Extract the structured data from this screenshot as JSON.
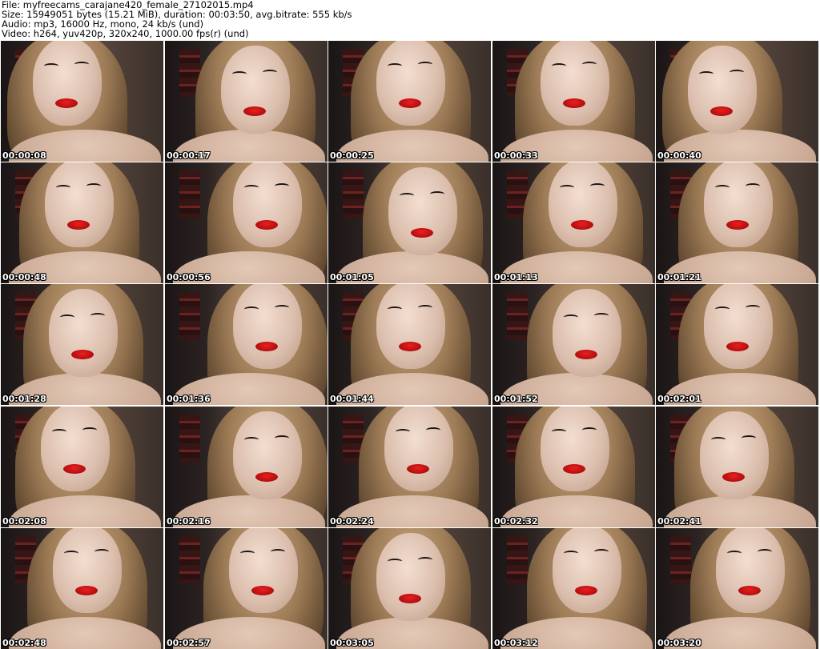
{
  "header": {
    "file": "File: myfreecams_carajane420_female_27102015.mp4",
    "size": "Size: 15949051 bytes (15.21 MiB), duration: 00:03:50, avg.bitrate: 555 kb/s",
    "audio": "Audio: mp3, 16000 Hz, mono, 24 kb/s (und)",
    "video": "Video: h264, yuv420p, 320x240, 1000.00 fps(r) (und)"
  },
  "thumbnails": [
    {
      "timestamp": "00:00:08"
    },
    {
      "timestamp": "00:00:17"
    },
    {
      "timestamp": "00:00:25"
    },
    {
      "timestamp": "00:00:33"
    },
    {
      "timestamp": "00:00:40"
    },
    {
      "timestamp": "00:00:48"
    },
    {
      "timestamp": "00:00:56"
    },
    {
      "timestamp": "00:01:05"
    },
    {
      "timestamp": "00:01:13"
    },
    {
      "timestamp": "00:01:21"
    },
    {
      "timestamp": "00:01:28"
    },
    {
      "timestamp": "00:01:36"
    },
    {
      "timestamp": "00:01:44"
    },
    {
      "timestamp": "00:01:52"
    },
    {
      "timestamp": "00:02:01"
    },
    {
      "timestamp": "00:02:08"
    },
    {
      "timestamp": "00:02:16"
    },
    {
      "timestamp": "00:02:24"
    },
    {
      "timestamp": "00:02:32"
    },
    {
      "timestamp": "00:02:41"
    },
    {
      "timestamp": "00:02:48"
    },
    {
      "timestamp": "00:02:57"
    },
    {
      "timestamp": "00:03:05"
    },
    {
      "timestamp": "00:03:12"
    },
    {
      "timestamp": "00:03:20"
    }
  ]
}
